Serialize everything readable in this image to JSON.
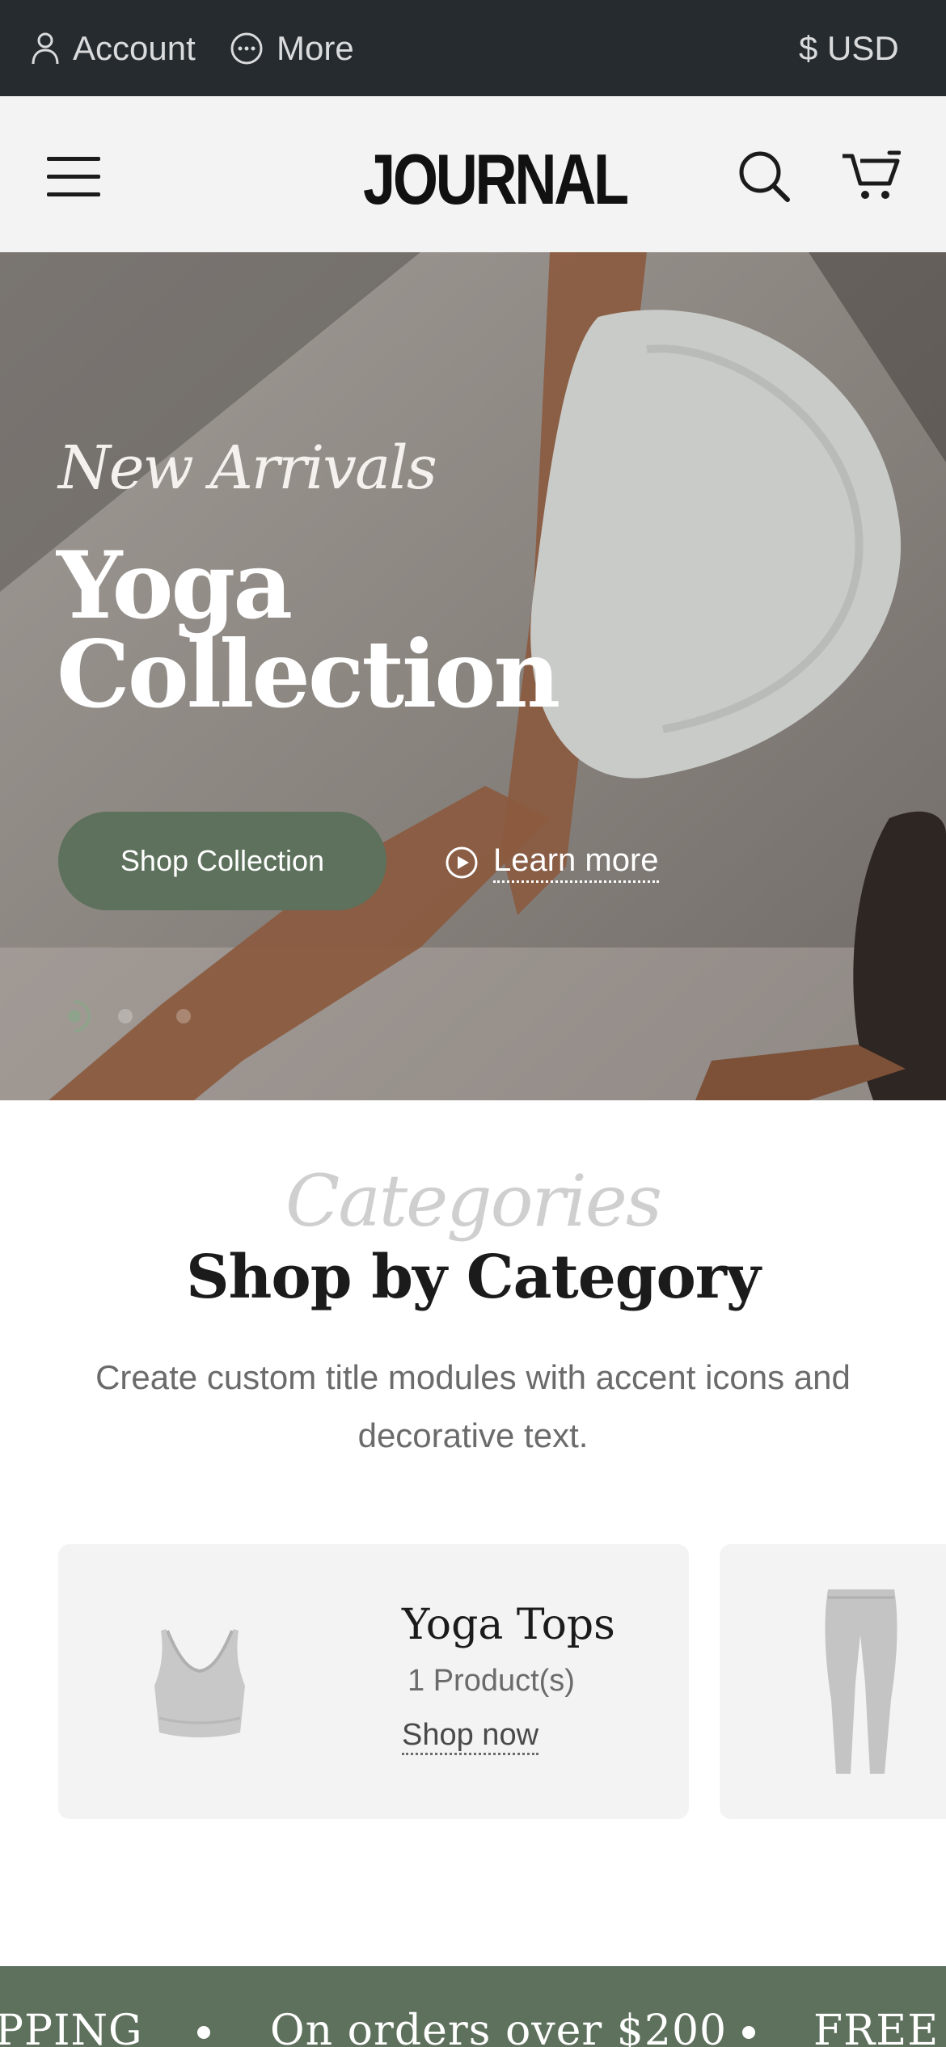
{
  "topbar": {
    "account_label": "Account",
    "more_label": "More",
    "currency_label": "$ USD"
  },
  "header": {
    "logo_text": "JOURNAL"
  },
  "hero": {
    "kicker": "New Arrivals",
    "title": "Yoga Collection",
    "primary_button": "Shop Collection",
    "secondary_link": "Learn more",
    "slides_total": 3,
    "active_slide": 1
  },
  "categories_section": {
    "kicker": "Categories",
    "title": "Shop by Category",
    "description": "Create custom title modules with accent icons and decorative text.",
    "cards": [
      {
        "title": "Yoga Tops",
        "count": "1  Product(s)",
        "link": "Shop now"
      }
    ]
  },
  "marquee": {
    "segments": [
      "PPING",
      "On orders over $200",
      "FREE"
    ]
  },
  "colors": {
    "topbar_bg": "#262b2f",
    "accent_green": "#5d715c",
    "header_bg": "#f4f3f3"
  }
}
